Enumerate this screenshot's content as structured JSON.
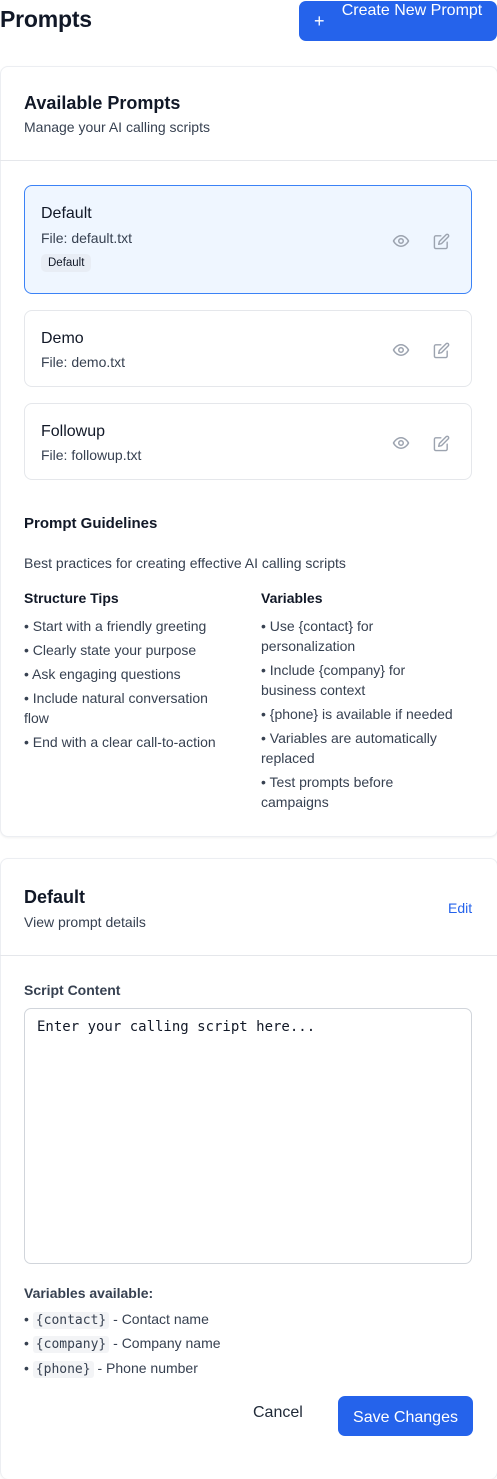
{
  "header": {
    "title": "Prompts",
    "create_button_icon": "plus-icon",
    "create_button_label": "Create New Prompt"
  },
  "available": {
    "title": "Available Prompts",
    "description": "Manage your AI calling scripts",
    "prompts": [
      {
        "name": "Default",
        "file": "File: default.txt",
        "badge": "Default",
        "active": true
      },
      {
        "name": "Demo",
        "file": "File: demo.txt",
        "active": false
      },
      {
        "name": "Followup",
        "file": "File: followup.txt",
        "active": false
      }
    ]
  },
  "guidelines": {
    "title": "Prompt Guidelines",
    "description": "Best practices for creating effective AI calling scripts",
    "structure": {
      "title": "Structure Tips",
      "items": [
        "• Start with a friendly greeting",
        "• Clearly state your purpose",
        "• Ask engaging questions",
        "• Include natural conversation flow",
        "• End with a clear call-to-action"
      ]
    },
    "variables": {
      "title": "Variables",
      "items": [
        "• Use {contact} for personalization",
        "• Include {company} for business context",
        "• {phone} is available if needed",
        "• Variables are automatically replaced",
        "• Test prompts before campaigns"
      ]
    }
  },
  "detail": {
    "title": "Default",
    "description": "View prompt details",
    "edit_label": "Edit",
    "script_label": "Script Content",
    "script_placeholder": "Enter your calling script here...",
    "script_value": "",
    "variables_title": "Variables available:",
    "variables": [
      {
        "code": "{contact}",
        "desc": " - Contact name"
      },
      {
        "code": "{company}",
        "desc": " - Company name"
      },
      {
        "code": "{phone}",
        "desc": " - Phone number"
      }
    ],
    "cancel_label": "Cancel",
    "save_label": "Save Changes"
  },
  "colors": {
    "primary": "#2563eb",
    "active_bg": "#eff6ff",
    "active_border": "#3b82f6"
  }
}
